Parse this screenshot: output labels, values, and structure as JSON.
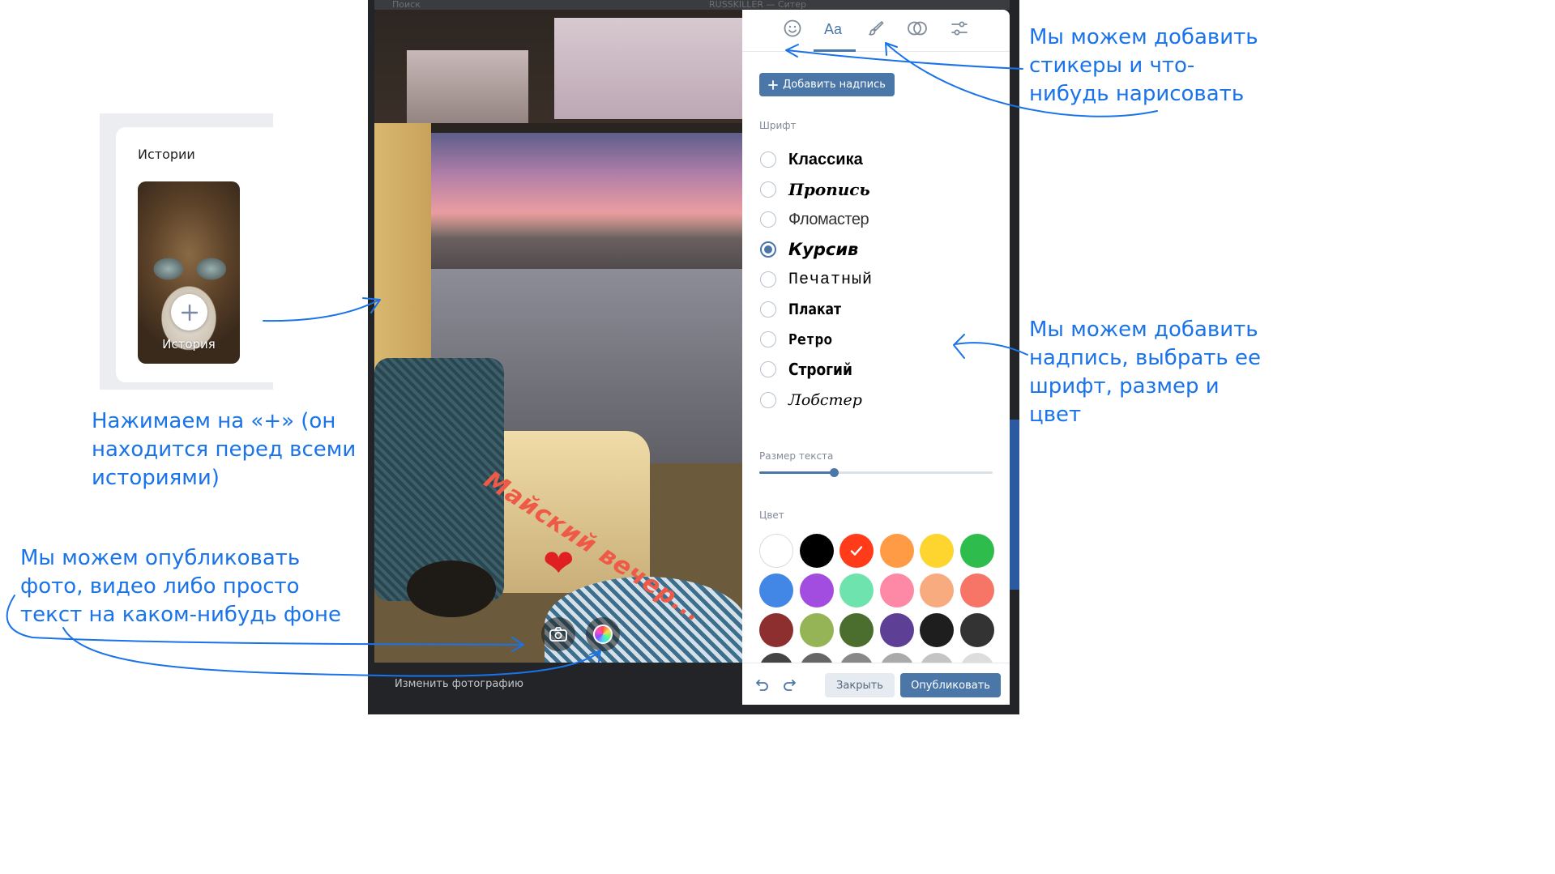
{
  "top_faint": {
    "search": "Поиск",
    "track": "RUSSKILLER — Ситер"
  },
  "stories_panel": {
    "title": "Истории",
    "add_label": "История"
  },
  "photo": {
    "overlay_text": "Майский вечер...",
    "change_photo": "Изменить фотографию",
    "camera_button_icon": "camera-icon",
    "background_button_icon": "color-wheel-icon"
  },
  "tabs": [
    {
      "name": "stickers",
      "icon": "smile-icon"
    },
    {
      "name": "text",
      "label": "Aa",
      "active": true
    },
    {
      "name": "draw",
      "icon": "brush-icon"
    },
    {
      "name": "filters",
      "icon": "filter-icon"
    },
    {
      "name": "adjust",
      "icon": "sliders-icon"
    }
  ],
  "panel": {
    "add_caption": "Добавить надпись",
    "font_label": "Шрифт",
    "fonts": [
      {
        "name": "Классика",
        "selected": false
      },
      {
        "name": "Пропись",
        "selected": false
      },
      {
        "name": "Фломастер",
        "selected": false
      },
      {
        "name": "Курсив",
        "selected": true
      },
      {
        "name": "Печатный",
        "selected": false
      },
      {
        "name": "Плакат",
        "selected": false
      },
      {
        "name": "Ретро",
        "selected": false
      },
      {
        "name": "Строгий",
        "selected": false
      },
      {
        "name": "Лобстер",
        "selected": false
      }
    ],
    "size_label": "Размер текста",
    "size_value": 0.32,
    "color_label": "Цвет",
    "colors": [
      "#ffffff",
      "#000000",
      "#ff3b1a",
      "#ff9a45",
      "#fdd52e",
      "#2ebd4c",
      "#4287e6",
      "#a24ce0",
      "#6fe3ae",
      "#fd89a6",
      "#f7ab7f",
      "#f77567",
      "#8e2f2f",
      "#95b455",
      "#4b6d2e",
      "#5d3f95",
      "#1e1e1e",
      "#333333",
      "#444444",
      "#666666",
      "#888888",
      "#aaaaaa",
      "#c4c4c4",
      "#dddddd"
    ],
    "selected_color": "#ff3b1a"
  },
  "footer": {
    "close": "Закрыть",
    "publish": "Опубликовать"
  },
  "annotations": {
    "plus": "Нажимаем на «+» (он находится перед всеми историями)",
    "publish_types": "Мы можем опубликовать фото, видео либо просто текст на каком-нибудь фоне",
    "stickers": "Мы можем добавить стикеры и что-нибудь нарисовать",
    "caption": "Мы можем добавить надпись, выбрать ее шрифт, размер и цвет"
  }
}
